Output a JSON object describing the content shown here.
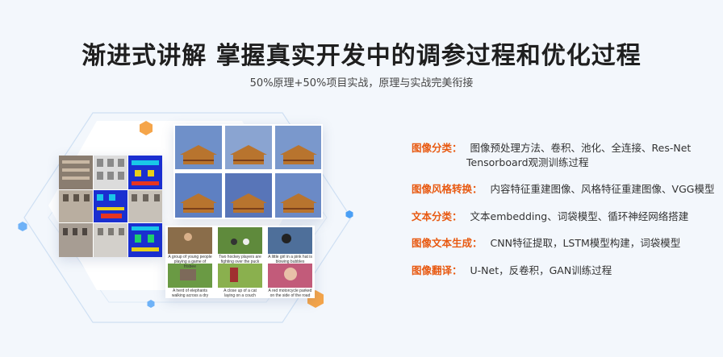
{
  "header": {
    "title": "渐进式讲解 掌握真实开发中的调参过程和优化过程",
    "subtitle": "50%原理+50%项目实战，原理与实战完美衔接"
  },
  "features": [
    {
      "label": "图像分类：",
      "text": "图像预处理方法、卷积、池化、全连接、Res-Net",
      "text2": "Tensorboard观测训练过程"
    },
    {
      "label": "图像风格转换：",
      "text": "内容特征重建图像、风格特征重建图像、VGG模型"
    },
    {
      "label": "文本分类：",
      "text": "文本embedding、词袋模型、循环神经网络搭建"
    },
    {
      "label": "图像文本生成：",
      "text": "CNN特征提取，LSTM模型构建，词袋模型"
    },
    {
      "label": "图像翻译：",
      "text": "U-Net，反卷积，GAN训练过程"
    }
  ],
  "captions": [
    "A group of young people playing a game of frisbee",
    "Two hockey players are fighting over the puck",
    "A little girl in a pink hat is blowing bubbles",
    "A herd of elephants walking across a dry grass field",
    "A close up of a cat laying on a couch",
    "A red motorcycle parked on the side of the road"
  ],
  "colors": {
    "accent": "#e85a12",
    "hex_orange": "#f5a54a",
    "hex_blue": "#4a9ff5"
  }
}
